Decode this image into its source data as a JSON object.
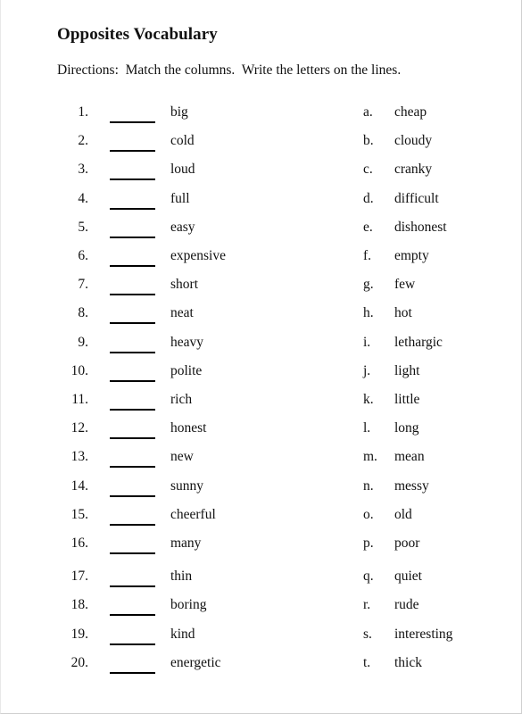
{
  "page": {
    "title": "Opposites Vocabulary",
    "directions": "Directions:  Match the columns.  Write the letters on the lines.",
    "background_color": "#ffffff",
    "text_color": "#111111",
    "border_color": "#cfcfcf"
  },
  "left_column": {
    "items": [
      {
        "number": "1.",
        "word": "big"
      },
      {
        "number": "2.",
        "word": "cold"
      },
      {
        "number": "3.",
        "word": "loud"
      },
      {
        "number": "4.",
        "word": "full"
      },
      {
        "number": "5.",
        "word": "easy"
      },
      {
        "number": "6.",
        "word": "expensive"
      },
      {
        "number": "7.",
        "word": "short"
      },
      {
        "number": "8.",
        "word": "neat"
      },
      {
        "number": "9.",
        "word": "heavy"
      },
      {
        "number": "10.",
        "word": "polite"
      },
      {
        "number": "11.",
        "word": "rich"
      },
      {
        "number": "12.",
        "word": "honest"
      },
      {
        "number": "13.",
        "word": "new"
      },
      {
        "number": "14.",
        "word": "sunny"
      },
      {
        "number": "15.",
        "word": "cheerful"
      },
      {
        "number": "16.",
        "word": "many"
      },
      {
        "number": "17.",
        "word": "thin"
      },
      {
        "number": "18.",
        "word": "boring"
      },
      {
        "number": "19.",
        "word": "kind"
      },
      {
        "number": "20.",
        "word": "energetic"
      }
    ]
  },
  "right_column": {
    "items": [
      {
        "letter": "a.",
        "word": "cheap"
      },
      {
        "letter": "b.",
        "word": "cloudy"
      },
      {
        "letter": "c.",
        "word": "cranky"
      },
      {
        "letter": "d.",
        "word": "difficult"
      },
      {
        "letter": "e.",
        "word": "dishonest"
      },
      {
        "letter": "f.",
        "word": "empty"
      },
      {
        "letter": "g.",
        "word": "few"
      },
      {
        "letter": "h.",
        "word": "hot"
      },
      {
        "letter": "i.",
        "word": "lethargic"
      },
      {
        "letter": "j.",
        "word": "light"
      },
      {
        "letter": "k.",
        "word": "little"
      },
      {
        "letter": "l.",
        "word": "long"
      },
      {
        "letter": "m.",
        "word": "mean"
      },
      {
        "letter": "n.",
        "word": "messy"
      },
      {
        "letter": "o.",
        "word": "old"
      },
      {
        "letter": "p.",
        "word": "poor"
      },
      {
        "letter": "q.",
        "word": "quiet"
      },
      {
        "letter": "r.",
        "word": "rude"
      },
      {
        "letter": "s.",
        "word": "interesting"
      },
      {
        "letter": "t.",
        "word": "thick"
      }
    ]
  }
}
